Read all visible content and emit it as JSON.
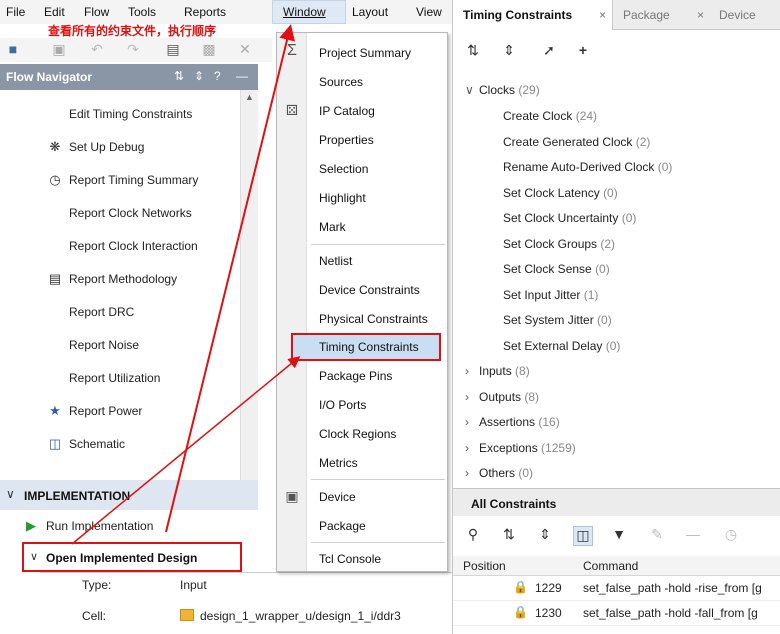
{
  "menubar": {
    "items": [
      "File",
      "Edit",
      "Flow",
      "Tools",
      "Reports",
      "Window",
      "Layout",
      "View"
    ]
  },
  "annotation": "查看所有的约束文件，执行顺序",
  "flow_navigator": {
    "title": "Flow Navigator",
    "items": [
      {
        "label": "Edit Timing Constraints",
        "icon": ""
      },
      {
        "label": "Set Up Debug",
        "icon": "bug-icon"
      },
      {
        "label": "Report Timing Summary",
        "icon": "clock-icon"
      },
      {
        "label": "Report Clock Networks",
        "icon": ""
      },
      {
        "label": "Report Clock Interaction",
        "icon": ""
      },
      {
        "label": "Report Methodology",
        "icon": "clipboard-icon"
      },
      {
        "label": "Report DRC",
        "icon": ""
      },
      {
        "label": "Report Noise",
        "icon": ""
      },
      {
        "label": "Report Utilization",
        "icon": ""
      },
      {
        "label": "Report Power",
        "icon": "power-icon"
      },
      {
        "label": "Schematic",
        "icon": "schematic-icon"
      }
    ],
    "implementation": {
      "header": "IMPLEMENTATION",
      "run": "Run Implementation",
      "open": "Open Implemented Design"
    }
  },
  "properties": {
    "type_key": "Type:",
    "type_val": "Input",
    "cell_key": "Cell:",
    "cell_val": "design_1_wrapper_u/design_1_i/ddr3"
  },
  "window_menu": {
    "items": [
      {
        "label": "Project Summary",
        "icon": "sigma-icon"
      },
      {
        "label": "Sources",
        "icon": ""
      },
      {
        "label": "IP Catalog",
        "icon": "ip-icon"
      },
      {
        "label": "Properties",
        "icon": ""
      },
      {
        "label": "Selection",
        "icon": ""
      },
      {
        "label": "Highlight",
        "icon": ""
      },
      {
        "label": "Mark",
        "icon": ""
      },
      {
        "label": "Netlist",
        "icon": ""
      },
      {
        "label": "Device Constraints",
        "icon": ""
      },
      {
        "label": "Physical Constraints",
        "icon": ""
      },
      {
        "label": "Timing Constraints",
        "icon": ""
      },
      {
        "label": "Package Pins",
        "icon": ""
      },
      {
        "label": "I/O Ports",
        "icon": ""
      },
      {
        "label": "Clock Regions",
        "icon": ""
      },
      {
        "label": "Metrics",
        "icon": ""
      },
      {
        "label": "Device",
        "icon": "chip-icon"
      },
      {
        "label": "Package",
        "icon": ""
      },
      {
        "label": "Tcl Console",
        "icon": ""
      }
    ]
  },
  "timing_panel": {
    "tabs": [
      "Timing Constraints",
      "Package",
      "Device"
    ],
    "clocks": {
      "label": "Clocks",
      "count": "(29)"
    },
    "clock_items": [
      {
        "label": "Create Clock",
        "count": "(24)"
      },
      {
        "label": "Create Generated Clock",
        "count": "(2)"
      },
      {
        "label": "Rename Auto-Derived Clock",
        "count": "(0)"
      },
      {
        "label": "Set Clock Latency",
        "count": "(0)"
      },
      {
        "label": "Set Clock Uncertainty",
        "count": "(0)"
      },
      {
        "label": "Set Clock Groups",
        "count": "(2)"
      },
      {
        "label": "Set Clock Sense",
        "count": "(0)"
      },
      {
        "label": "Set Input Jitter",
        "count": "(1)"
      },
      {
        "label": "Set System Jitter",
        "count": "(0)"
      },
      {
        "label": "Set External Delay",
        "count": "(0)"
      }
    ],
    "groups": [
      {
        "label": "Inputs",
        "count": "(8)"
      },
      {
        "label": "Outputs",
        "count": "(8)"
      },
      {
        "label": "Assertions",
        "count": "(16)"
      },
      {
        "label": "Exceptions",
        "count": "(1259)"
      },
      {
        "label": "Others",
        "count": "(0)"
      }
    ],
    "all_constraints": {
      "title": "All Constraints",
      "col_position": "Position",
      "col_command": "Command",
      "rows": [
        {
          "position": "1229",
          "command": "set_false_path -hold -rise_from [g"
        },
        {
          "position": "1230",
          "command": "set_false_path -hold -fall_from [g"
        }
      ]
    }
  },
  "colors": {
    "annotation": "#e01010",
    "menu_highlight": "#c9ddf3",
    "nav_header": "#8a96a6"
  }
}
